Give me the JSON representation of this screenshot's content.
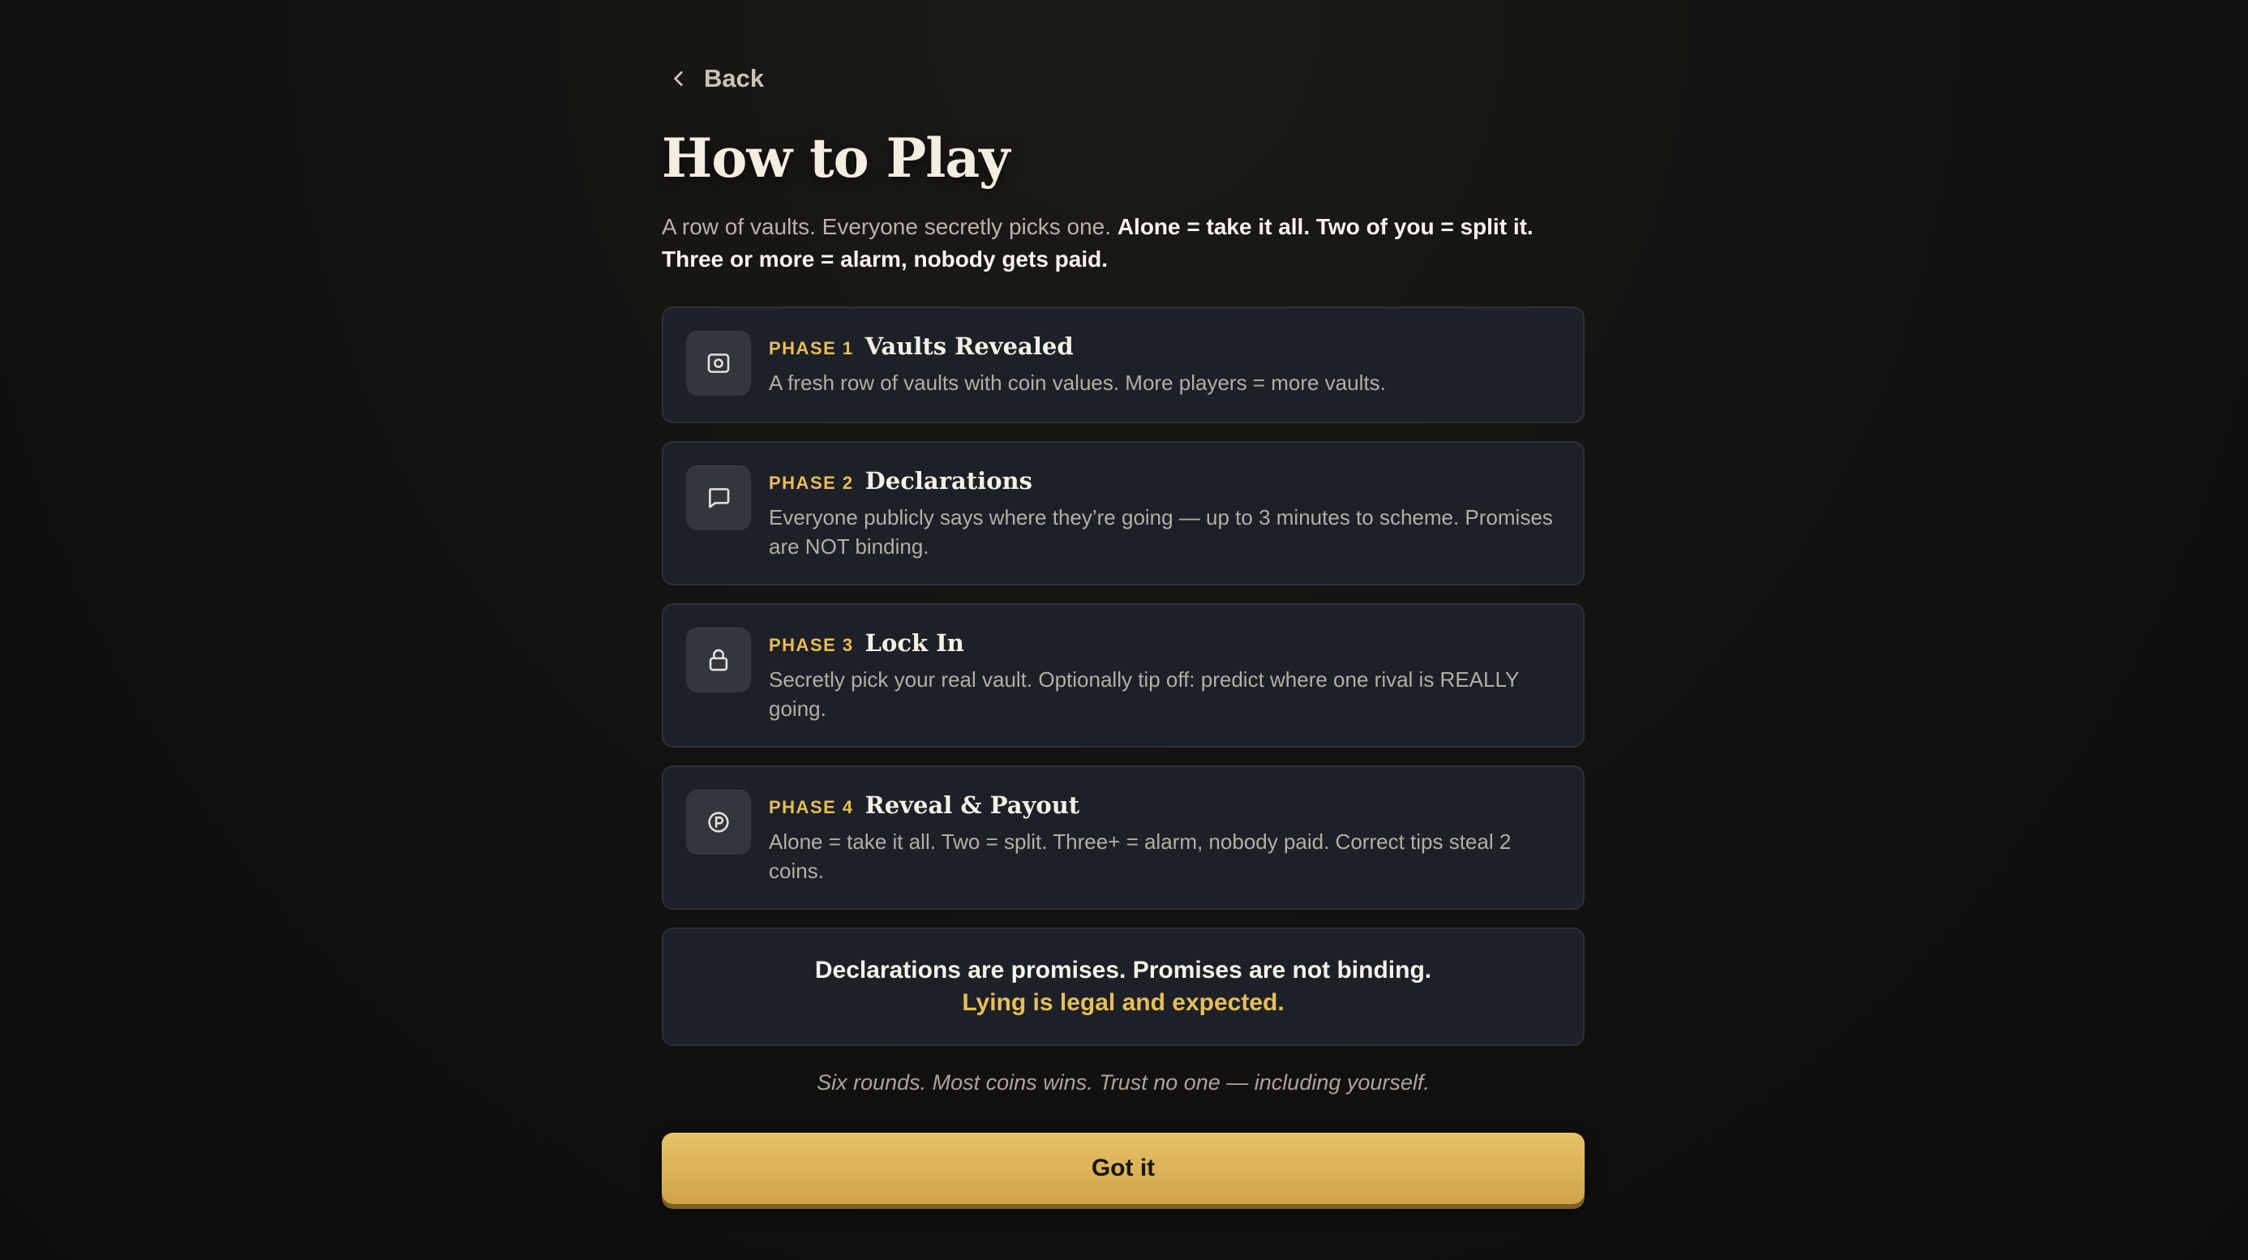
{
  "nav": {
    "back_label": "Back"
  },
  "page": {
    "title": "How to Play"
  },
  "intro": {
    "plain": "A row of vaults. Everyone secretly picks one. ",
    "bold": "Alone = take it all. Two of you = split it. Three or more = alarm, nobody gets paid."
  },
  "phases": [
    {
      "label": "PHASE 1",
      "title": "Vaults Revealed",
      "description": "A fresh row of vaults with coin values. More players = more vaults.",
      "icon": "vault-icon"
    },
    {
      "label": "PHASE 2",
      "title": "Declarations",
      "description": "Everyone publicly says where they’re going — up to 3 minutes to scheme. Promises are NOT binding.",
      "icon": "chat-bubble-icon"
    },
    {
      "label": "PHASE 3",
      "title": "Lock In",
      "description": "Secretly pick your real vault. Optionally tip off: predict where one rival is REALLY going.",
      "icon": "lock-icon"
    },
    {
      "label": "PHASE 4",
      "title": "Reveal & Payout",
      "description": "Alone = take it all. Two = split. Three+ = alarm, nobody paid. Correct tips steal 2 coins.",
      "icon": "coin-icon"
    }
  ],
  "notice": {
    "line1": "Declarations are promises. Promises are not binding.",
    "line2": "Lying is legal and expected."
  },
  "tagline": "Six rounds. Most coins wins. Trust no one — including yourself.",
  "cta": {
    "label": "Got it"
  },
  "colors": {
    "accent": "#e8be57",
    "card_bg": "#1e2027",
    "button_top": "#e8c467",
    "button_bottom": "#cfa34a"
  }
}
